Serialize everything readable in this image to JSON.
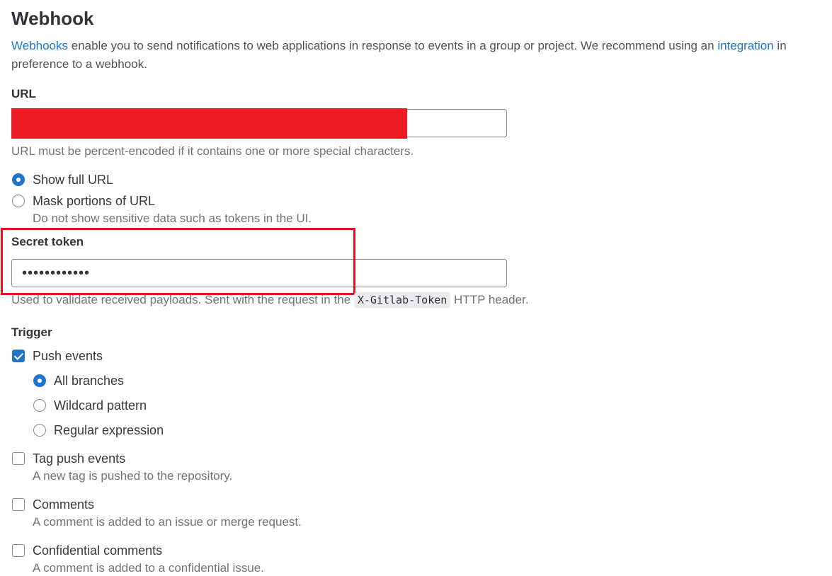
{
  "page": {
    "title": "Webhook",
    "intro_link1": "Webhooks",
    "intro_text1": " enable you to send notifications to web applications in response to events in a group or project. We recommend using an ",
    "intro_link2": "integration",
    "intro_text2": " in preference to a webhook."
  },
  "url": {
    "label": "URL",
    "help": "URL must be percent-encoded if it contains one or more special characters.",
    "options": [
      {
        "label": "Show full URL",
        "selected": true
      },
      {
        "label": "Mask portions of URL",
        "selected": false,
        "help": "Do not show sensitive data such as tokens in the UI."
      }
    ]
  },
  "secret": {
    "label": "Secret token",
    "value": "••••••••••••",
    "help_before": "Used to validate received payloads. Sent with the request in the ",
    "header_code": "X-Gitlab-Token",
    "help_after": " HTTP header."
  },
  "trigger": {
    "label": "Trigger",
    "push": {
      "label": "Push events",
      "checked": true
    },
    "branch_options": [
      {
        "label": "All branches",
        "selected": true
      },
      {
        "label": "Wildcard pattern",
        "selected": false
      },
      {
        "label": "Regular expression",
        "selected": false
      }
    ],
    "tag_push": {
      "label": "Tag push events",
      "help": "A new tag is pushed to the repository."
    },
    "comments": {
      "label": "Comments",
      "help": "A comment is added to an issue or merge request."
    },
    "confidential": {
      "label": "Confidential comments",
      "help": "A comment is added to a confidential issue."
    }
  },
  "colors": {
    "accent": "#1f75cb",
    "redaction": "#ed1c24",
    "highlight": "#e3141d"
  }
}
